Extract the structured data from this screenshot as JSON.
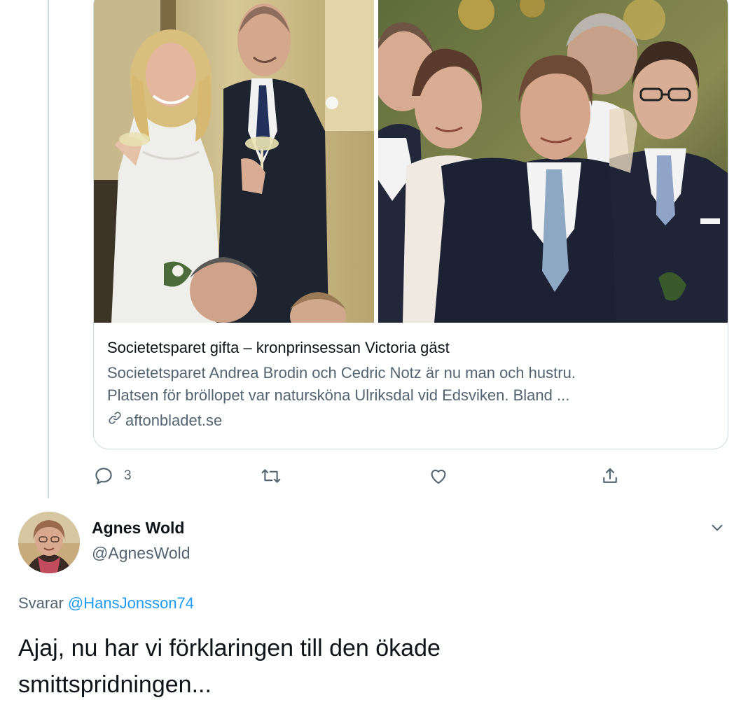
{
  "card": {
    "title": "Societetsparet gifta – kronprinsessan Victoria gäst",
    "description_line1": "Societetsparet Andrea Brodin och Cedric Notz är nu man och hustru.",
    "description_line2": "Platsen för bröllopet var natursköna Ulriksdal vid Edsviken. Bland ...",
    "domain": "aftonbladet.se",
    "link_icon": "link-icon",
    "image_left_icon": "wedding-couple-photo",
    "image_right_icon": "wedding-guests-photo"
  },
  "actions": {
    "reply_count": "3",
    "reply_icon": "reply-icon",
    "retweet_icon": "retweet-icon",
    "like_icon": "like-icon",
    "share_icon": "share-icon"
  },
  "tweet": {
    "author_name": "Agnes Wold",
    "author_handle": "@AgnesWold",
    "reply_prefix": "Svarar",
    "reply_mention": "@HansJonsson74",
    "text_line1": "Ajaj, nu har vi förklaringen till den ökade",
    "text_line2": "smittspridningen...",
    "more_icon": "chevron-down-icon"
  },
  "colors": {
    "text": "#0f1419",
    "secondary": "#536471",
    "link": "#1d9bf0",
    "border": "#cfd9de"
  }
}
